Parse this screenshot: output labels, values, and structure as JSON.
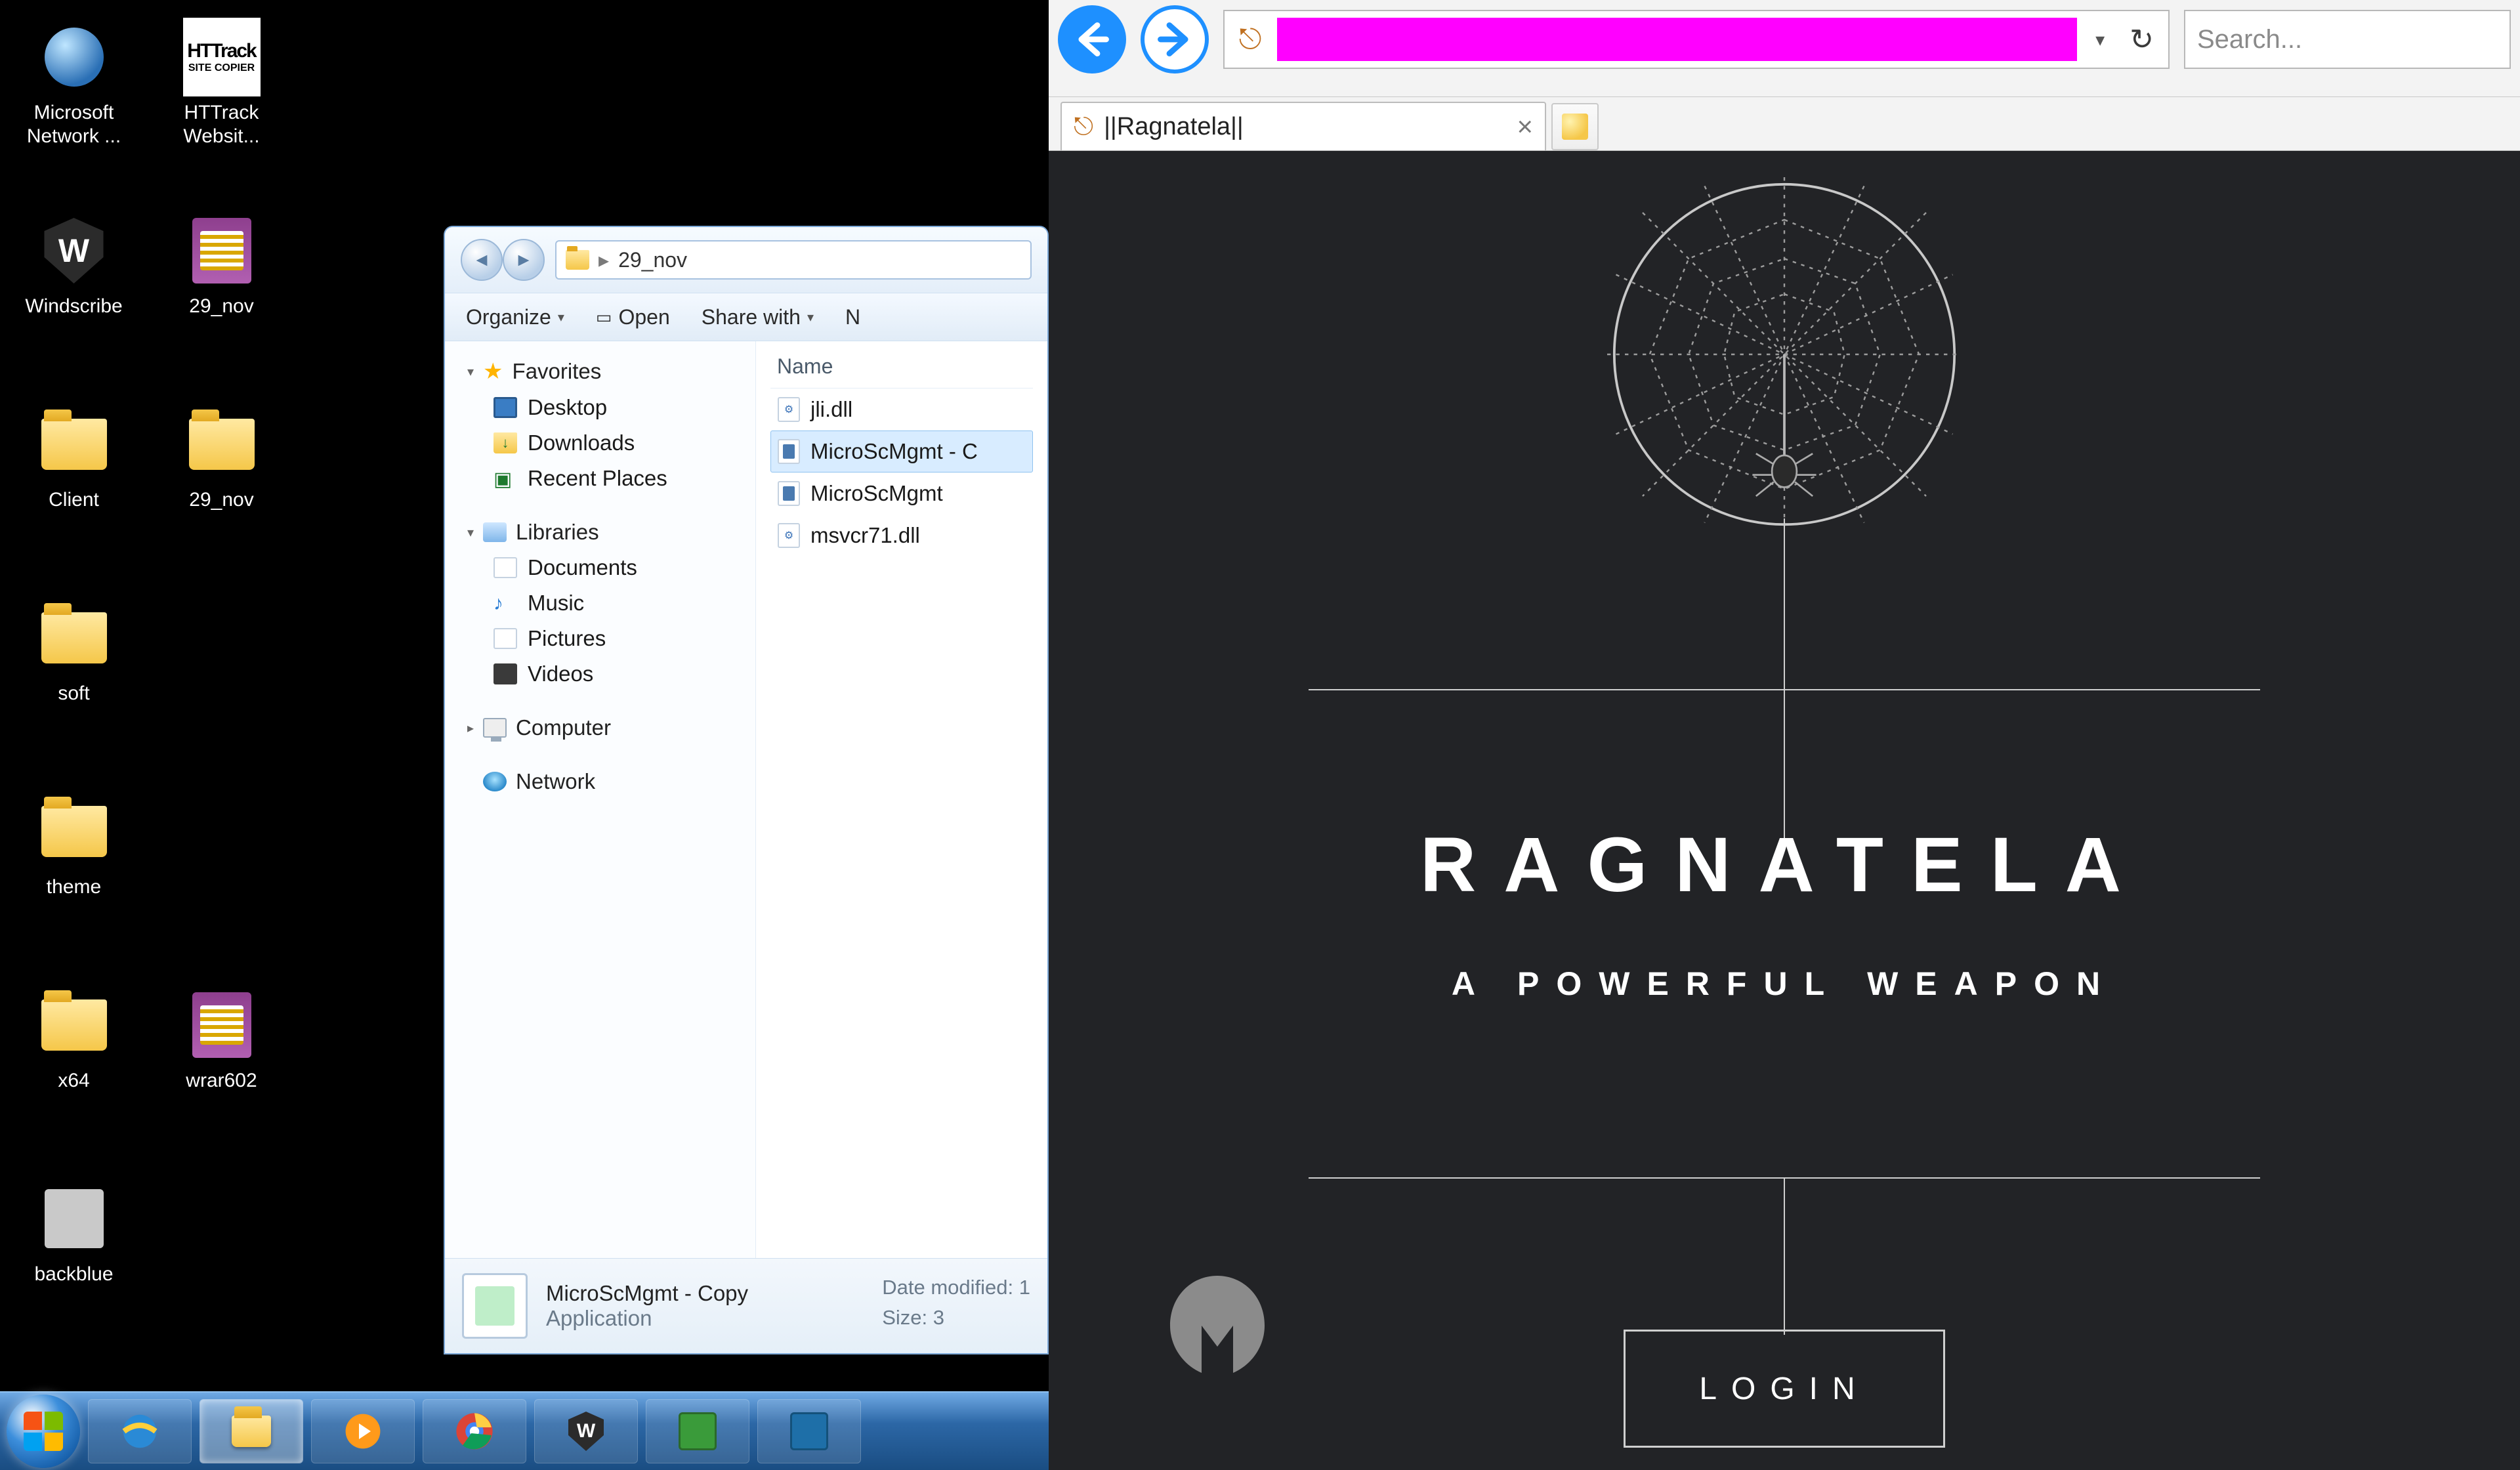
{
  "desktop": {
    "icons_col1": [
      {
        "label": "Microsoft Network ...",
        "kind": "msnet"
      },
      {
        "label": "Windscribe",
        "kind": "windscribe"
      },
      {
        "label": "Client",
        "kind": "folder"
      },
      {
        "label": "soft",
        "kind": "folder"
      },
      {
        "label": "theme",
        "kind": "folder"
      },
      {
        "label": "x64",
        "kind": "folder"
      },
      {
        "label": "backblue",
        "kind": "blank"
      }
    ],
    "icons_col2": [
      {
        "label": "HTTrack Websit...",
        "kind": "httrack"
      },
      {
        "label": "29_nov",
        "kind": "winrar"
      },
      {
        "label": "29_nov",
        "kind": "folder"
      }
    ],
    "icons_col3": [
      {
        "label": "wrar602",
        "kind": "winrar"
      }
    ]
  },
  "explorer": {
    "breadcrumb_label": "29_nov",
    "toolbar": {
      "organize": "Organize",
      "open": "Open",
      "share_with": "Share with",
      "next_cut": "N"
    },
    "sidebar": {
      "favorites_head": "Favorites",
      "favorites": [
        {
          "label": "Desktop",
          "icon": "desktop"
        },
        {
          "label": "Downloads",
          "icon": "downloads"
        },
        {
          "label": "Recent Places",
          "icon": "recent"
        }
      ],
      "libraries_head": "Libraries",
      "libraries": [
        {
          "label": "Documents"
        },
        {
          "label": "Music"
        },
        {
          "label": "Pictures"
        },
        {
          "label": "Videos"
        }
      ],
      "computer": "Computer",
      "network": "Network"
    },
    "files": {
      "header": "Name",
      "rows": [
        {
          "name": "jli.dll",
          "kind": "dll",
          "selected": false
        },
        {
          "name": "MicroScMgmt - C",
          "kind": "app",
          "selected": true
        },
        {
          "name": "MicroScMgmt",
          "kind": "app",
          "selected": false
        },
        {
          "name": "msvcr71.dll",
          "kind": "dll",
          "selected": false
        }
      ]
    },
    "details": {
      "filename": "MicroScMgmt - Copy",
      "filetype": "Application",
      "date_modified_label": "Date modified:",
      "date_modified_cut": "1",
      "size_label": "Size:",
      "size_cut": "3"
    }
  },
  "taskbar": {
    "items": [
      "ie",
      "explorer",
      "wmp",
      "chrome",
      "windscribe",
      "procexp",
      "wireshark"
    ]
  },
  "browser": {
    "search_placeholder": "Search...",
    "tab_title": "||Ragnatela||"
  },
  "page": {
    "title": "RAGNATELA",
    "subtitle": "A POWERFUL WEAPON",
    "login": "LOGIN"
  }
}
